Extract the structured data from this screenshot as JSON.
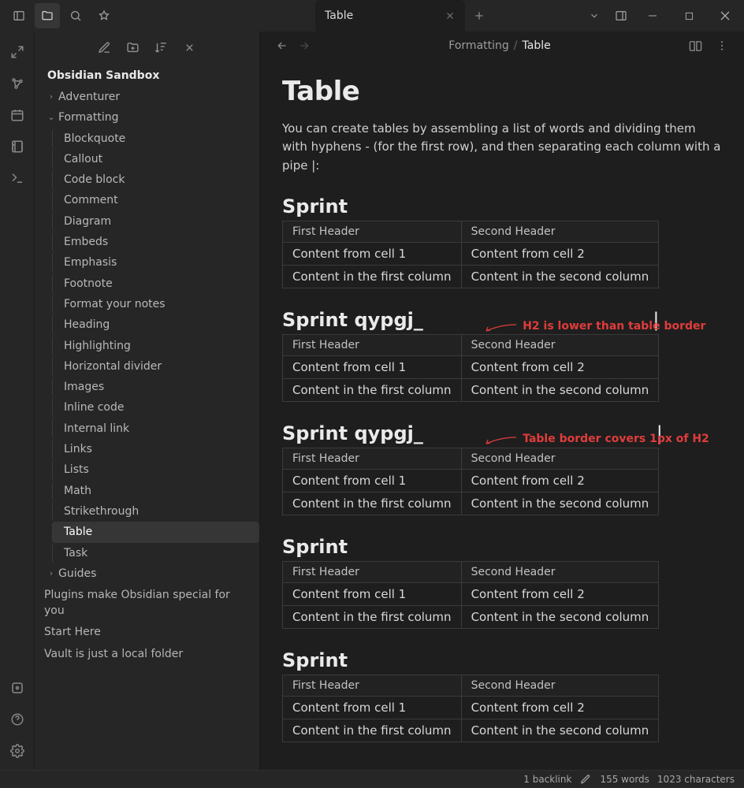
{
  "titlebar": {
    "tab_label": "Table"
  },
  "sidebar": {
    "vault_name": "Obsidian Sandbox",
    "folders": [
      {
        "label": "Adventurer",
        "expanded": false
      },
      {
        "label": "Formatting",
        "expanded": true,
        "children": [
          "Blockquote",
          "Callout",
          "Code block",
          "Comment",
          "Diagram",
          "Embeds",
          "Emphasis",
          "Footnote",
          "Format your notes",
          "Heading",
          "Highlighting",
          "Horizontal divider",
          "Images",
          "Inline code",
          "Internal link",
          "Links",
          "Lists",
          "Math",
          "Strikethrough",
          "Table",
          "Task"
        ],
        "selected": "Table"
      },
      {
        "label": "Guides",
        "expanded": false
      }
    ],
    "notes": [
      "Plugins make Obsidian special for you",
      "Start Here",
      "Vault is just a local folder"
    ]
  },
  "breadcrumb": {
    "parent": "Formatting",
    "sep": "/",
    "current": "Table"
  },
  "doc": {
    "title": "Table",
    "intro": "You can create tables by assembling a list of words and dividing them with hyphens - (for the first row), and then separating each column with a pipe |:",
    "table_headers": [
      "First Header",
      "Second Header"
    ],
    "table_rows": [
      [
        "Content from cell 1",
        "Content from cell 2"
      ],
      [
        "Content in the first column",
        "Content in the second column"
      ]
    ],
    "sections": [
      {
        "heading": "Sprint",
        "annotation": ""
      },
      {
        "heading": "Sprint qypgj_",
        "annotation": "H2 is lower than table border",
        "cursor": true
      },
      {
        "heading": "Sprint qypgj_",
        "annotation": "Table border covers 1px of H2",
        "cursor": true
      },
      {
        "heading": "Sprint",
        "annotation": ""
      },
      {
        "heading": "Sprint",
        "annotation": ""
      }
    ]
  },
  "status": {
    "backlinks": "1 backlink",
    "words": "155 words",
    "chars": "1023 characters"
  }
}
